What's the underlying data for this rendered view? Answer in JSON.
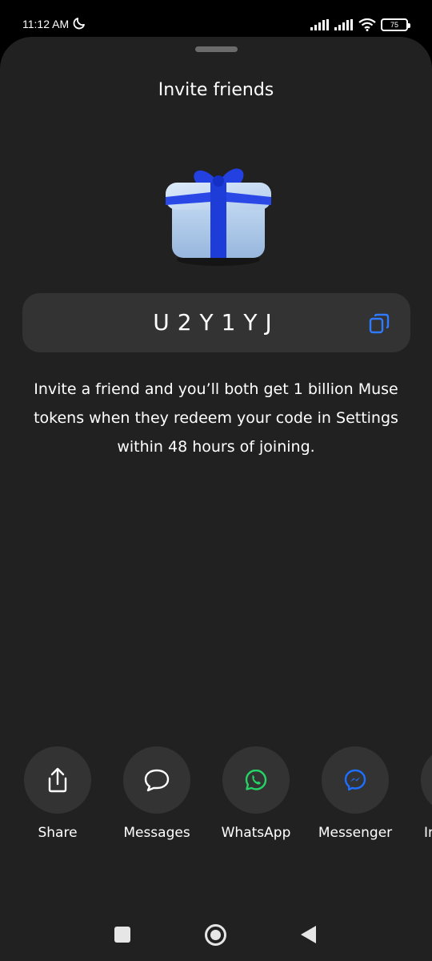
{
  "status_bar": {
    "time": "11:12 AM",
    "battery": "75"
  },
  "sheet": {
    "title": "Invite friends",
    "invite_code": "U2Y1YJ",
    "description": "Invite a friend and you’ll both get 1 billion Muse tokens when they redeem your code in Settings within 48 hours of joining."
  },
  "share_options": [
    {
      "label": "Share",
      "icon": "share-icon"
    },
    {
      "label": "Messages",
      "icon": "chat-bubble-icon"
    },
    {
      "label": "WhatsApp",
      "icon": "whatsapp-icon"
    },
    {
      "label": "Messenger",
      "icon": "messenger-icon"
    },
    {
      "label": "In",
      "icon": "unknown-icon"
    }
  ],
  "colors": {
    "background": "#212121",
    "chip": "#333333",
    "whatsapp_green": "#25D366",
    "messenger_blue": "#1E6FFF",
    "gift_box": "#B9D4F2",
    "gift_ribbon": "#1E3CD8",
    "copy_icon": "#2F7BFF"
  }
}
